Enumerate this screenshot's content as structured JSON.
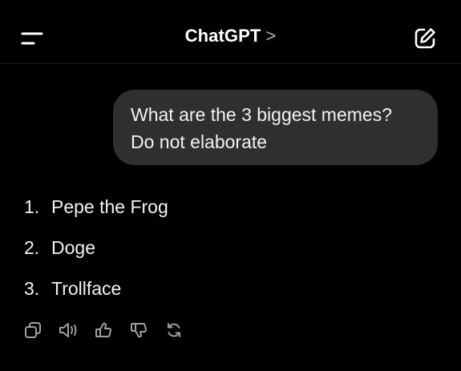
{
  "header": {
    "title": "ChatGPT",
    "title_chevron": ">",
    "menu_icon": "menu-icon",
    "new_chat_icon": "compose-icon"
  },
  "conversation": {
    "user_message": {
      "line1": "What are the 3 biggest memes?",
      "line2": "Do not elaborate"
    },
    "assistant_answer": {
      "items": [
        {
          "number": "1.",
          "text": "Pepe the Frog"
        },
        {
          "number": "2.",
          "text": "Doge"
        },
        {
          "number": "3.",
          "text": "Trollface"
        }
      ]
    },
    "actions": [
      "copy-icon",
      "read-aloud-icon",
      "thumbs-up-icon",
      "thumbs-down-icon",
      "regenerate-icon"
    ]
  },
  "colors": {
    "background": "#000000",
    "bubble": "#2f2f2f",
    "text": "#f2f2f2",
    "icon": "#a0a0a0"
  }
}
